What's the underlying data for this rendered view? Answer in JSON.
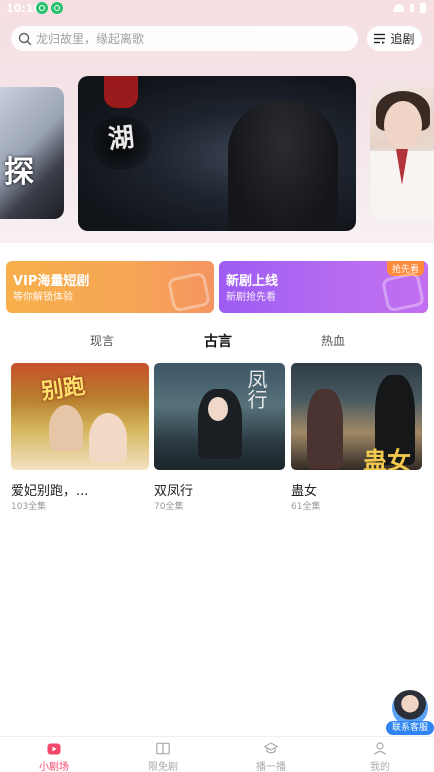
{
  "status_bar": {
    "time": "10:10"
  },
  "search": {
    "placeholder": "龙归故里，缘起离歌"
  },
  "header": {
    "follow_label": "追剧"
  },
  "promo_cards": [
    {
      "title": "VIP海量短剧",
      "subtitle": "等你解锁体验"
    },
    {
      "title": "新剧上线",
      "subtitle": "新剧抢先看",
      "badge": "抢先看"
    }
  ],
  "category_tabs": [
    {
      "label": "现言",
      "active": false
    },
    {
      "label": "古言",
      "active": true
    },
    {
      "label": "热血",
      "active": false
    }
  ],
  "dramas": [
    {
      "title": "爱妃别跑，...",
      "episodes": "103全集"
    },
    {
      "title": "双凤行",
      "episodes": "70全集"
    },
    {
      "title": "蛊女",
      "episodes": "61全集"
    }
  ],
  "poster_text": {
    "p2": "凤行",
    "p3": "蛊女"
  },
  "banner_text": {
    "main": "湖"
  },
  "support": {
    "label": "联系客服"
  },
  "bottom_nav": [
    {
      "label": "小剧场",
      "icon": "theater-icon",
      "active": true
    },
    {
      "label": "限免剧",
      "icon": "book-icon",
      "active": false
    },
    {
      "label": "播一播",
      "icon": "cap-icon",
      "active": false
    },
    {
      "label": "我的",
      "icon": "user-icon",
      "active": false
    }
  ],
  "colors": {
    "accent": "#f0476b",
    "vip": "#f7a556",
    "new": "#b66cf1"
  }
}
